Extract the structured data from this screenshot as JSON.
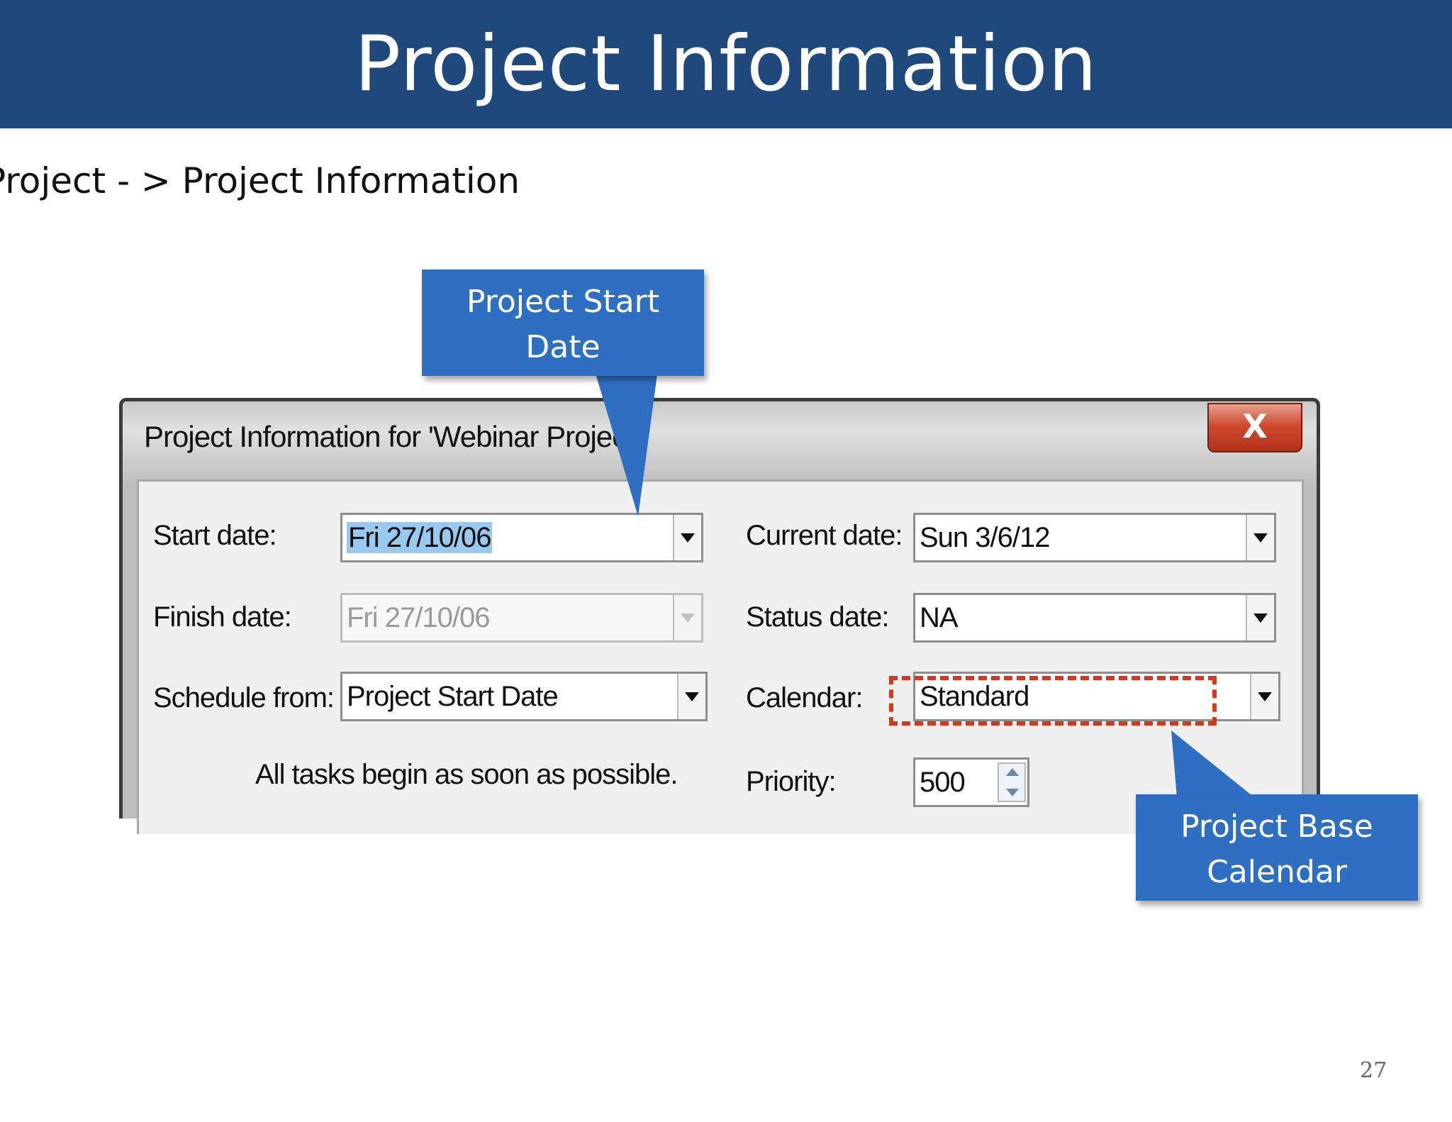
{
  "slide": {
    "title": "Project Information",
    "breadcrumb": "Project - > Project Information",
    "page_number": "27"
  },
  "dialog": {
    "title": "Project Information for 'Webinar Project'",
    "close_label": "X",
    "fields": {
      "start_date": {
        "label": "Start date:",
        "value": "Fri 27/10/06"
      },
      "finish_date": {
        "label": "Finish date:",
        "value": "Fri 27/10/06"
      },
      "schedule_from": {
        "label": "Schedule from:",
        "value": "Project Start Date"
      },
      "current_date": {
        "label": "Current date:",
        "value": "Sun 3/6/12"
      },
      "status_date": {
        "label": "Status date:",
        "value": "NA"
      },
      "calendar": {
        "label": "Calendar:",
        "value": "Standard"
      },
      "priority": {
        "label": "Priority:",
        "value": "500"
      }
    },
    "schedule_note": "All tasks begin as soon as possible."
  },
  "callouts": {
    "start_date": {
      "line1": "Project Start",
      "line2": "Date"
    },
    "base_calendar": {
      "line1": "Project Base",
      "line2": "Calendar"
    }
  },
  "colors": {
    "title_bar": "#1f497d",
    "callout": "#2e6fc1",
    "highlight_dash": "#d23a1c",
    "close_button": "#cf4a2f",
    "selection": "#99c9ef"
  }
}
